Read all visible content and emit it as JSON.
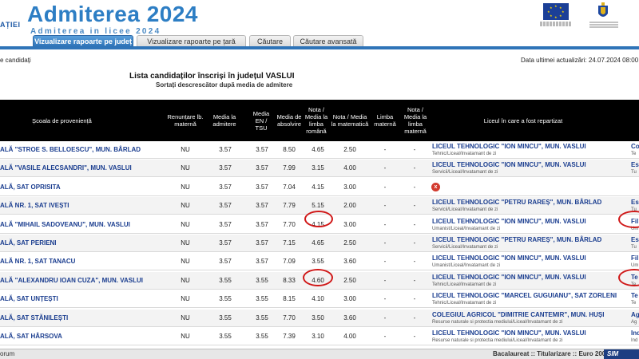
{
  "header": {
    "cut_left": "AȚIEI",
    "title": "Admiterea 2024",
    "subtitle": "Admiterea in licee 2024"
  },
  "tabs": [
    {
      "label": "Vizualizare rapoarte pe județ",
      "active": true
    },
    {
      "label": "Vizualizare rapoarte pe țară",
      "active": false
    },
    {
      "label": "Căutare",
      "active": false
    },
    {
      "label": "Căutare avansată",
      "active": false
    }
  ],
  "info": {
    "left": "e candidați",
    "right": "Data ultimei actualizări: 24.07.2024 08:00"
  },
  "list": {
    "title": "Lista candidaților înscriși în județul VASLUI",
    "subtitle": "Sortați descrescător după media de admitere"
  },
  "columns": [
    "Școala de proveniență",
    "Renunțare lb. maternă",
    "Media la admitere",
    "Media EN / TSU",
    "Media de absolvire",
    "Nota / Media la limba română",
    "Nota / Media la matematică",
    "Limba maternă",
    "Nota / Media la limba maternă",
    "Liceul în care a fost repartizat"
  ],
  "rows": [
    {
      "school": "ALĂ \"STROE S. BELLOESCU\", MUN. BÂRLAD",
      "ren": "NU",
      "adm": "3.57",
      "en": "3.57",
      "abs": "8.50",
      "rom": "4.65",
      "mat": "2.50",
      "lm": "-",
      "nlm": "-",
      "liceu": "LICEUL TEHNOLOGIC \"ION MINCU\", MUN. VASLUI",
      "profil": "Tehnic/Liceal/Invatamant de zi",
      "spec_a": "Co",
      "spec_b": "Te"
    },
    {
      "school": "ALĂ \"VASILE ALECSANDRI\", MUN. VASLUI",
      "ren": "NU",
      "adm": "3.57",
      "en": "3.57",
      "abs": "7.99",
      "rom": "3.15",
      "mat": "4.00",
      "lm": "-",
      "nlm": "-",
      "liceu": "LICEUL TEHNOLOGIC \"ION MINCU\", MUN. VASLUI",
      "profil": "Servicii/Liceal/Invatamant de zi",
      "spec_a": "Es",
      "spec_b": "Tu"
    },
    {
      "school": "ALĂ, SAT OPRISITA",
      "ren": "NU",
      "adm": "3.57",
      "en": "3.57",
      "abs": "7.04",
      "rom": "4.15",
      "mat": "3.00",
      "lm": "-",
      "nlm": "-",
      "liceu": "",
      "profil": "",
      "spec_a": "",
      "spec_b": "",
      "x": "x"
    },
    {
      "school": "ALĂ NR. 1, SAT IVEȘTI",
      "ren": "NU",
      "adm": "3.57",
      "en": "3.57",
      "abs": "7.79",
      "rom": "5.15",
      "mat": "2.00",
      "lm": "-",
      "nlm": "-",
      "liceu": "LICEUL TEHNOLOGIC \"PETRU RAREȘ\", MUN. BÂRLAD",
      "profil": "Servicii/Liceal/Invatamant de zi",
      "spec_a": "Es",
      "spec_b": "Tu"
    },
    {
      "school": "ALĂ \"MIHAIL SADOVEANU\", MUN. VASLUI",
      "ren": "NU",
      "adm": "3.57",
      "en": "3.57",
      "abs": "7.70",
      "rom": "4.15",
      "mat": "3.00",
      "lm": "-",
      "nlm": "-",
      "liceu": "LICEUL TEHNOLOGIC \"ION MINCU\", MUN. VASLUI",
      "profil": "Umanist/Liceal/Invatamant de zi",
      "spec_a": "Fil",
      "spec_b": "Um"
    },
    {
      "school": "ALĂ, SAT PERIENI",
      "ren": "NU",
      "adm": "3.57",
      "en": "3.57",
      "abs": "7.15",
      "rom": "4.65",
      "mat": "2.50",
      "lm": "-",
      "nlm": "-",
      "liceu": "LICEUL TEHNOLOGIC \"PETRU RAREȘ\", MUN. BÂRLAD",
      "profil": "Servicii/Liceal/Invatamant de zi",
      "spec_a": "Es",
      "spec_b": "Tu"
    },
    {
      "school": "ALĂ NR. 1, SAT TANACU",
      "ren": "NU",
      "adm": "3.57",
      "en": "3.57",
      "abs": "7.09",
      "rom": "3.55",
      "mat": "3.60",
      "lm": "-",
      "nlm": "-",
      "liceu": "LICEUL TEHNOLOGIC \"ION MINCU\", MUN. VASLUI",
      "profil": "Umanist/Liceal/Invatamant de zi",
      "spec_a": "Fil",
      "spec_b": "Um"
    },
    {
      "school": "ALĂ \"ALEXANDRU IOAN CUZA\", MUN. VASLUI",
      "ren": "NU",
      "adm": "3.55",
      "en": "3.55",
      "abs": "8.33",
      "rom": "4.60",
      "mat": "2.50",
      "lm": "-",
      "nlm": "-",
      "liceu": "LICEUL TEHNOLOGIC \"ION MINCU\", MUN. VASLUI",
      "profil": "Tehnic/Liceal/Invatamant de zi",
      "spec_a": "Te",
      "spec_b": "Te"
    },
    {
      "school": "ALĂ, SAT UNȚEȘTI",
      "ren": "NU",
      "adm": "3.55",
      "en": "3.55",
      "abs": "8.15",
      "rom": "4.10",
      "mat": "3.00",
      "lm": "-",
      "nlm": "-",
      "liceu": "LICEUL TEHNOLOGIC \"MARCEL GUGUIANU\", SAT ZORLENI",
      "profil": "Tehnic/Liceal/Invatamant de zi",
      "spec_a": "Te",
      "spec_b": "Te"
    },
    {
      "school": "ALĂ, SAT STĂNILEȘTI",
      "ren": "NU",
      "adm": "3.55",
      "en": "3.55",
      "abs": "7.70",
      "rom": "3.50",
      "mat": "3.60",
      "lm": "-",
      "nlm": "-",
      "liceu": "COLEGIUL AGRICOL \"DIMITRIE CANTEMIR\", MUN. HUȘI",
      "profil": "Resurse naturale si protectia mediului/Liceal/Invatamant de zi",
      "spec_a": "Ag",
      "spec_b": "Ag"
    },
    {
      "school": "ALĂ, SAT HÂRSOVA",
      "ren": "NU",
      "adm": "3.55",
      "en": "3.55",
      "abs": "7.39",
      "rom": "3.10",
      "mat": "4.00",
      "lm": "-",
      "nlm": "-",
      "liceu": "LICEUL TEHNOLOGIC \"ION MINCU\", MUN. VASLUI",
      "profil": "Resurse naturale si protectia mediului/Liceal/Invatamant de zi",
      "spec_a": "Ind",
      "spec_b": "Ind"
    }
  ],
  "footer": {
    "left": "orum",
    "right": "Bacalaureat :: Titularizare :: Euro 200",
    "badge": "SIM"
  },
  "colors": {
    "accent": "#2f74b8",
    "link": "#1a3d8f",
    "highlight_circle": "#d01818"
  }
}
